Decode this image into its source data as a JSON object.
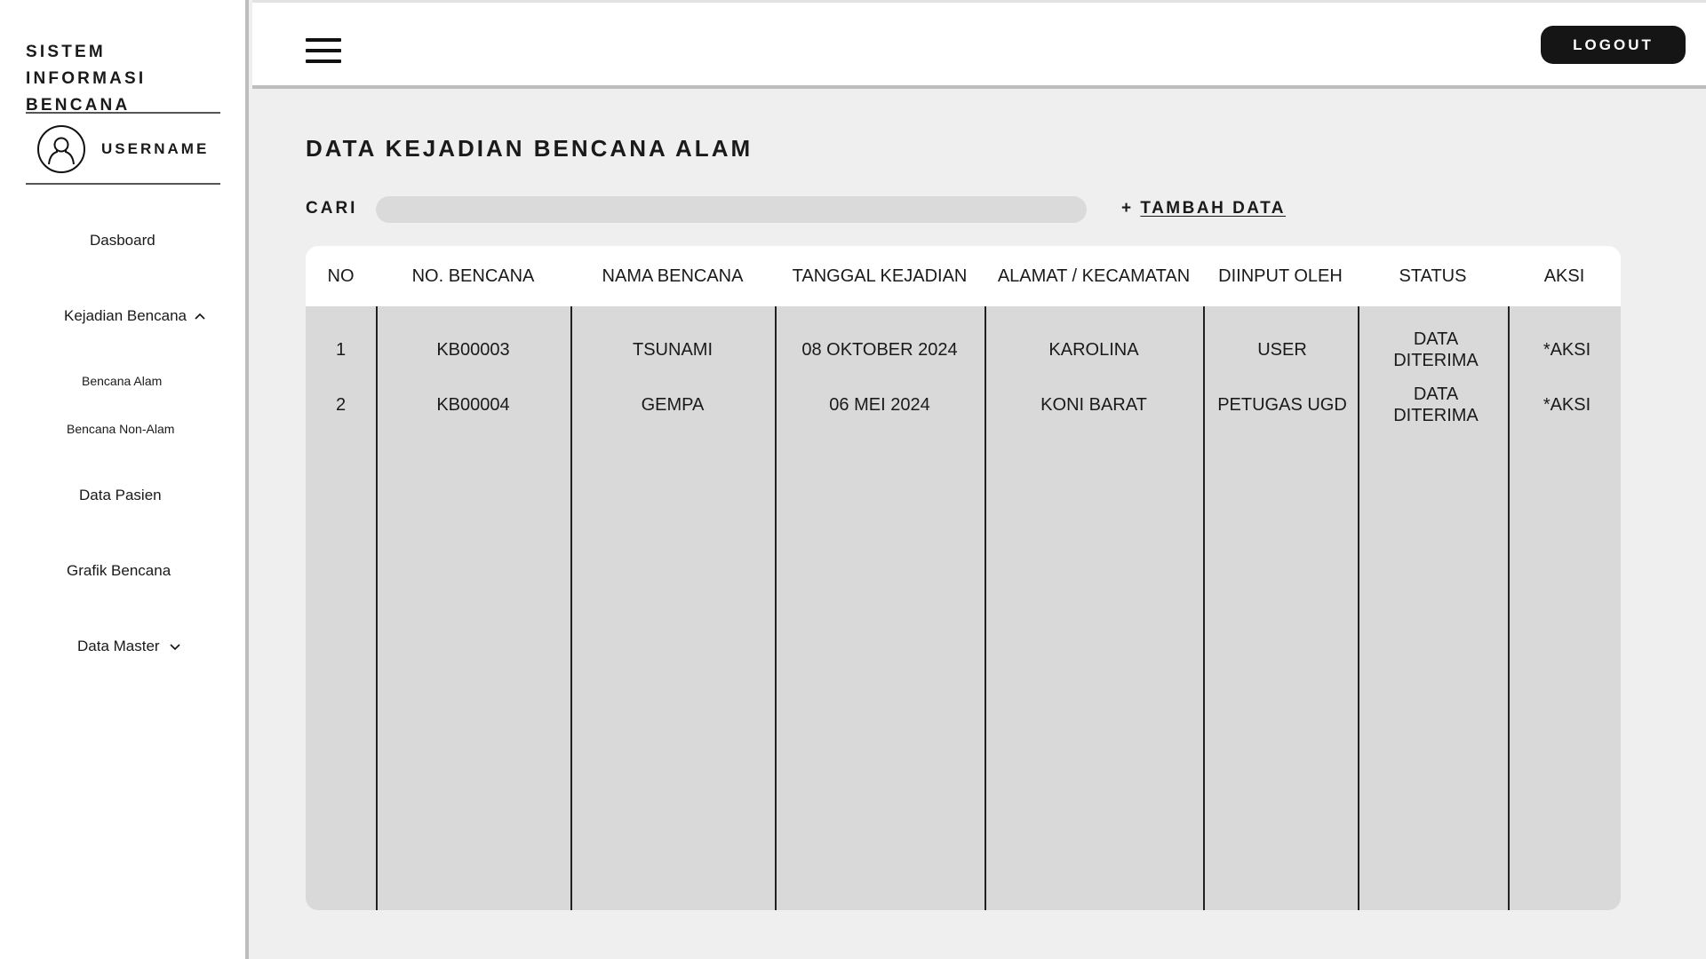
{
  "sidebar": {
    "brand": "SISTEM INFORMASI BENCANA",
    "username": "USERNAME",
    "nav": {
      "dashboard": "Dasboard",
      "kejadian": "Kejadian Bencana",
      "bencana_alam": "Bencana Alam",
      "bencana_non_alam": "Bencana Non-Alam",
      "data_pasien": "Data Pasien",
      "grafik": "Grafik Bencana",
      "data_master": "Data Master"
    }
  },
  "topbar": {
    "logout_label": "LOGOUT"
  },
  "main": {
    "title": "DATA KEJADIAN BENCANA ALAM",
    "search_label": "CARI",
    "search_value": "",
    "add_prefix": "+",
    "add_label": "TAMBAH DATA"
  },
  "table": {
    "headers": [
      "NO",
      "NO. BENCANA",
      "NAMA BENCANA",
      "TANGGAL KEJADIAN",
      "ALAMAT / KECAMATAN",
      "DIINPUT OLEH",
      "STATUS",
      "AKSI"
    ],
    "rows": [
      [
        "1",
        "KB00003",
        "TSUNAMI",
        "08 OKTOBER 2024",
        "KAROLINA",
        "USER",
        "DATA DITERIMA",
        "*AKSI"
      ],
      [
        "2",
        "KB00004",
        "GEMPA",
        "06 MEI 2024",
        "KONI BARAT",
        "PETUGAS UGD",
        "DATA DITERIMA",
        "*AKSI"
      ]
    ]
  }
}
